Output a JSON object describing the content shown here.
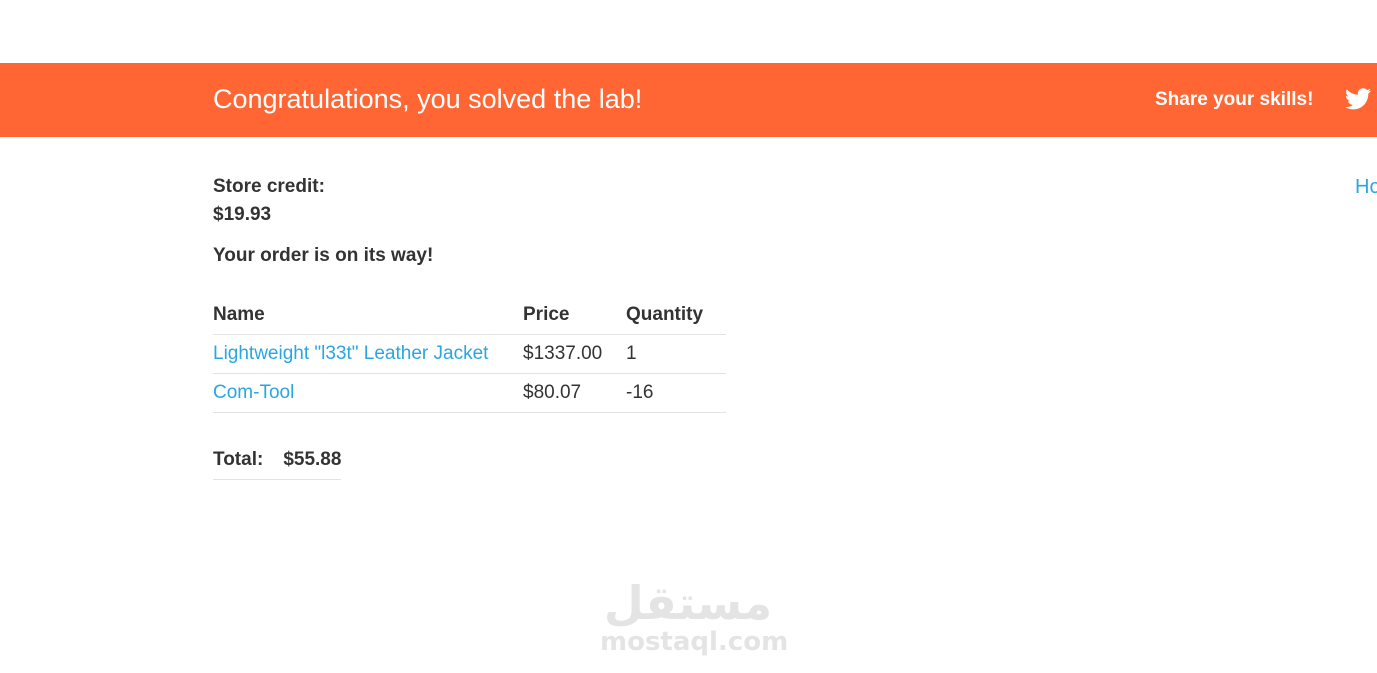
{
  "banner": {
    "title": "Congratulations, you solved the lab!",
    "share_label": "Share your skills!",
    "share_icon": "twitter-icon",
    "background_color": "#ff6633"
  },
  "header": {
    "home_link": "Home"
  },
  "account": {
    "store_credit_label": "Store credit:",
    "store_credit_value": "$19.93"
  },
  "order": {
    "message": "Your order is on its way!",
    "columns": [
      "Name",
      "Price",
      "Quantity"
    ],
    "rows": [
      {
        "name": "Lightweight \"l33t\" Leather Jacket",
        "price": "$1337.00",
        "quantity": "1"
      },
      {
        "name": "Com-Tool",
        "price": "$80.07",
        "quantity": "-16"
      }
    ],
    "total_label": "Total:",
    "total_value": "$55.88"
  },
  "watermark": {
    "arabic": "مستقل",
    "latin": "mostaql.com"
  },
  "colors": {
    "accent": "#ff6633",
    "link": "#2aa6e0",
    "text": "#333333"
  }
}
